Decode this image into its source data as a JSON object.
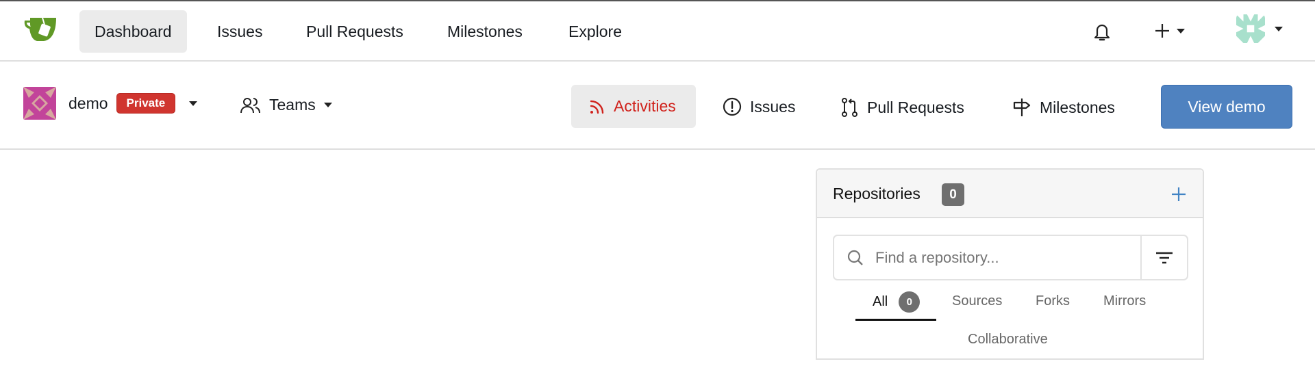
{
  "navbar": {
    "items": [
      "Dashboard",
      "Issues",
      "Pull Requests",
      "Milestones",
      "Explore"
    ],
    "active": "Dashboard",
    "icons": [
      "gitea-logo-icon",
      "bell-icon",
      "plus-icon",
      "user-avatar"
    ]
  },
  "org": {
    "name": "demo",
    "visibility": "Private",
    "teams_label": "Teams",
    "tabs": [
      {
        "label": "Activities",
        "icon": "rss-icon",
        "active": true
      },
      {
        "label": "Issues",
        "icon": "issue-icon"
      },
      {
        "label": "Pull Requests",
        "icon": "pull-request-icon"
      },
      {
        "label": "Milestones",
        "icon": "milestone-icon"
      }
    ],
    "view_button": "View demo"
  },
  "repos": {
    "title": "Repositories",
    "count": "0",
    "search_placeholder": "Find a repository...",
    "tabs": [
      "All",
      "Sources",
      "Forks",
      "Mirrors",
      "Collaborative"
    ],
    "all_count": "0"
  },
  "colors": {
    "accent_red": "#d0352f",
    "primary": "#4f82c0",
    "active_tab_text": "#d0211b"
  }
}
